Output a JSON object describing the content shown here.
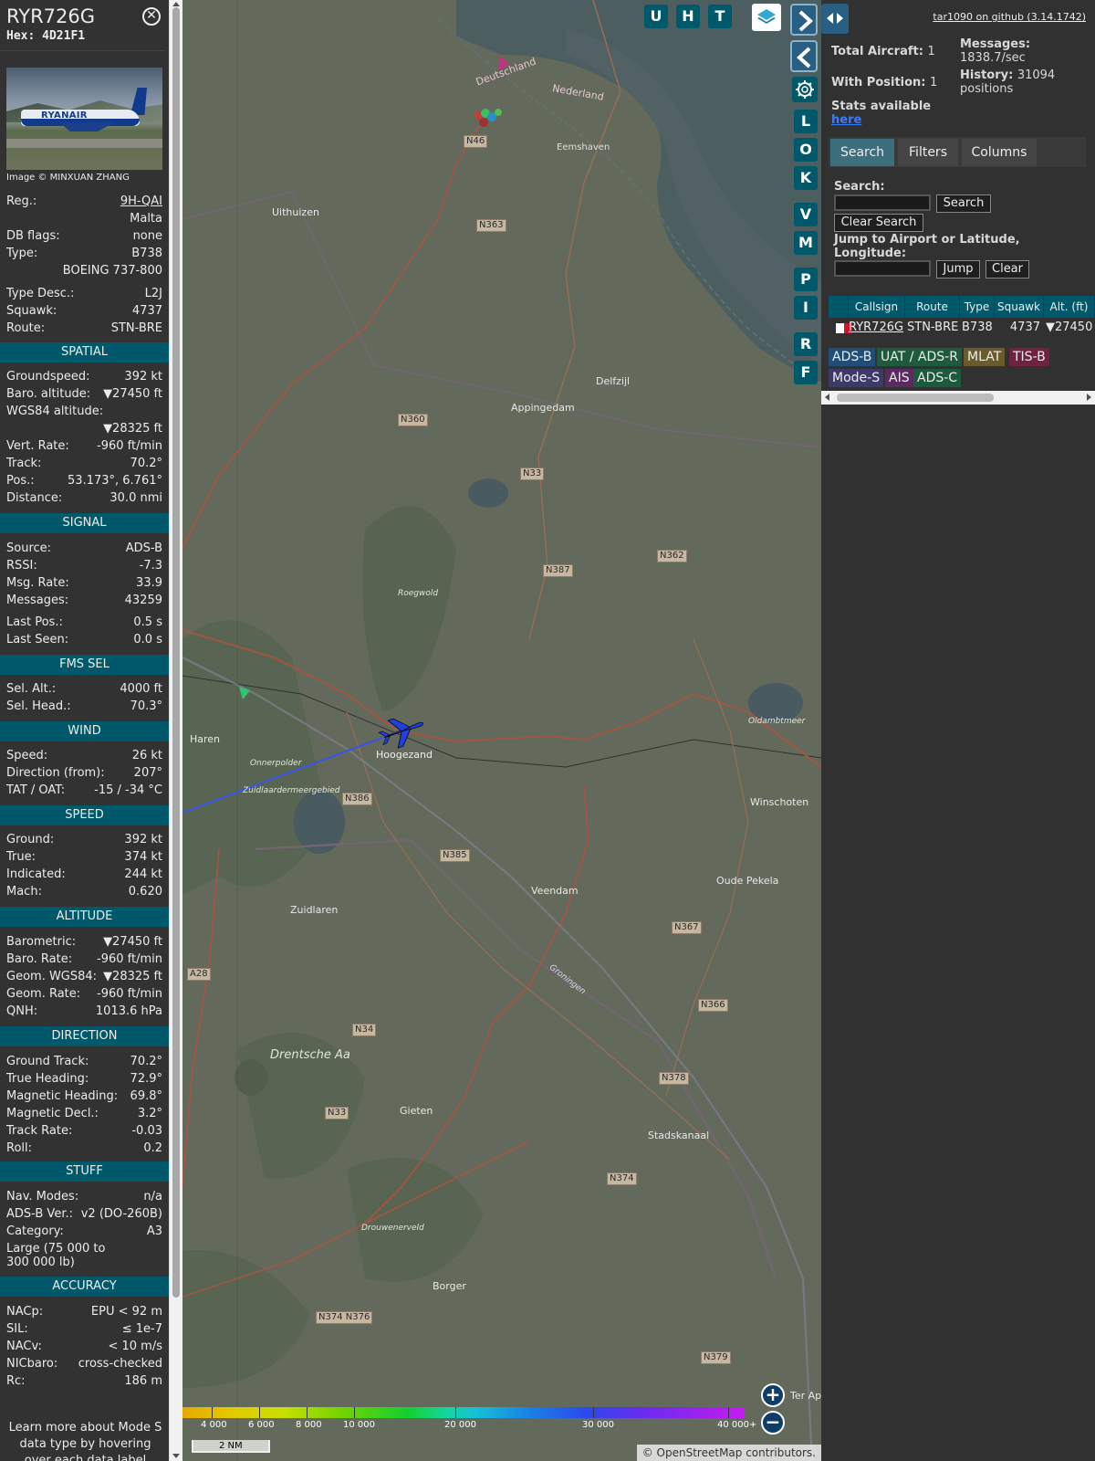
{
  "info": {
    "callsign": "RYR726G",
    "hex_label": "Hex:",
    "hex": "4D21F1",
    "photo_credit": "Image © MINXUAN ZHANG",
    "photo_brand": "RYANAIR",
    "rows_top": [
      {
        "k": "Reg.:",
        "v": "9H-QAI"
      },
      {
        "k": "",
        "v": "Malta"
      },
      {
        "k": "DB flags:",
        "v": "none"
      },
      {
        "k": "Type:",
        "v": "B738"
      },
      {
        "k": "",
        "v": "BOEING 737-800"
      }
    ],
    "rows_top2": [
      {
        "k": "Type Desc.:",
        "v": "L2J"
      },
      {
        "k": "Squawk:",
        "v": "4737"
      },
      {
        "k": "Route:",
        "v": "STN-BRE"
      }
    ],
    "sections": {
      "spatial": "SPATIAL",
      "signal": "SIGNAL",
      "fms": "FMS SEL",
      "wind": "WIND",
      "speed": "SPEED",
      "altitude": "ALTITUDE",
      "direction": "DIRECTION",
      "stuff": "STUFF",
      "accuracy": "ACCURACY"
    },
    "spatial": [
      {
        "k": "Groundspeed:",
        "v": "392 kt"
      },
      {
        "k": "Baro. altitude:",
        "v": "▼27450 ft"
      },
      {
        "k": "WGS84 altitude:",
        "v": ""
      },
      {
        "k": "",
        "v": "▼28325 ft"
      },
      {
        "k": "Vert. Rate:",
        "v": "-960 ft/min"
      },
      {
        "k": "Track:",
        "v": "70.2°"
      },
      {
        "k": "Pos.:",
        "v": "53.173°, 6.761°"
      },
      {
        "k": "Distance:",
        "v": "30.0 nmi"
      }
    ],
    "signal": [
      {
        "k": "Source:",
        "v": "ADS-B"
      },
      {
        "k": "RSSI:",
        "v": "-7.3"
      },
      {
        "k": "Msg. Rate:",
        "v": "33.9"
      },
      {
        "k": "Messages:",
        "v": "43259"
      }
    ],
    "signal2": [
      {
        "k": "Last Pos.:",
        "v": "0.5 s"
      },
      {
        "k": "Last Seen:",
        "v": "0.0 s"
      }
    ],
    "fms": [
      {
        "k": "Sel. Alt.:",
        "v": "4000 ft"
      },
      {
        "k": "Sel. Head.:",
        "v": "70.3°"
      }
    ],
    "wind": [
      {
        "k": "Speed:",
        "v": "26 kt"
      },
      {
        "k": "Direction (from):",
        "v": "207°"
      },
      {
        "k": "TAT / OAT:",
        "v": "-15 / -34 °C"
      }
    ],
    "speed": [
      {
        "k": "Ground:",
        "v": "392 kt"
      },
      {
        "k": "True:",
        "v": "374 kt"
      },
      {
        "k": "Indicated:",
        "v": "244 kt"
      },
      {
        "k": "Mach:",
        "v": "0.620"
      }
    ],
    "altitude": [
      {
        "k": "Barometric:",
        "v": "▼27450 ft"
      },
      {
        "k": "Baro. Rate:",
        "v": "-960 ft/min"
      },
      {
        "k": "Geom. WGS84:",
        "v": "▼28325 ft"
      },
      {
        "k": "Geom. Rate:",
        "v": "-960 ft/min"
      },
      {
        "k": "QNH:",
        "v": "1013.6 hPa"
      }
    ],
    "direction": [
      {
        "k": "Ground Track:",
        "v": "70.2°"
      },
      {
        "k": "True Heading:",
        "v": "72.9°"
      },
      {
        "k": "Magnetic Heading:",
        "v": "69.8°"
      },
      {
        "k": "Magnetic Decl.:",
        "v": "3.2°"
      },
      {
        "k": "Track Rate:",
        "v": "-0.03"
      },
      {
        "k": "Roll:",
        "v": "0.2"
      }
    ],
    "stuff": [
      {
        "k": "Nav. Modes:",
        "v": "n/a"
      },
      {
        "k": "ADS-B Ver.:",
        "v": "v2 (DO-260B)"
      },
      {
        "k": "Category:",
        "v": "A3"
      }
    ],
    "category_desc_1": "Large (75 000 to",
    "category_desc_2": "300 000 lb)",
    "accuracy": [
      {
        "k": "NACp:",
        "v": "EPU < 92 m"
      },
      {
        "k": "SIL:",
        "v": "≤ 1e-7"
      },
      {
        "k": "NACv:",
        "v": "< 10 m/s"
      },
      {
        "k": "NICbaro:",
        "v": "cross-checked"
      },
      {
        "k": "Rc:",
        "v": "186 m"
      }
    ],
    "footer": "Learn more about Mode S data type by hovering over each data label"
  },
  "map": {
    "buttons": [
      "U",
      "H",
      "T"
    ],
    "side_buttons": [
      "L",
      "O",
      "K",
      "V",
      "M",
      "P",
      "I",
      "R",
      "F"
    ],
    "places": [
      {
        "name": "Deutschland"
      },
      {
        "name": "Nederland"
      },
      {
        "name": "Eemshaven"
      },
      {
        "name": "Uithuizen"
      },
      {
        "name": "Delfzijl"
      },
      {
        "name": "Appingedam"
      },
      {
        "name": "Hoogezand"
      },
      {
        "name": "Haren"
      },
      {
        "name": "Winschoten"
      },
      {
        "name": "Veendam"
      },
      {
        "name": "Zuidlaren"
      },
      {
        "name": "Oude Pekela"
      },
      {
        "name": "Gieten"
      },
      {
        "name": "Stadskanaal"
      },
      {
        "name": "Borger"
      },
      {
        "name": "Drentsche Aa"
      },
      {
        "name": "Roegwold"
      },
      {
        "name": "Onnerpolder"
      },
      {
        "name": "Zuidlaardermeergebied"
      },
      {
        "name": "Oldambtmeer"
      },
      {
        "name": "Drouwenerveld"
      },
      {
        "name": "Groningen"
      },
      {
        "name": "Ter Ap"
      }
    ],
    "roads": [
      "N46",
      "N363",
      "N360",
      "N33",
      "N362",
      "N387",
      "N386",
      "N385",
      "N367",
      "N366",
      "N34",
      "N378",
      "N33",
      "N374",
      "N374 N376",
      "N379",
      "A28"
    ],
    "colorbar_labels": [
      "4 000",
      "6 000",
      "8 000",
      "10 000",
      "20 000",
      "30 000",
      "40 000+"
    ],
    "scale": "2 NM",
    "attribution": "© OpenStreetMap contributors."
  },
  "sidebar": {
    "github": "tar1090 on github (3.14.1742)",
    "total_label": "Total Aircraft:",
    "total": "1",
    "withpos_label": "With Position:",
    "withpos": "1",
    "messages_label": "Messages:",
    "messages": "1838.7/sec",
    "history_label": "History:",
    "history": "31094 positions",
    "stats_label": "Stats available",
    "stats_link": "here",
    "tabs": [
      "Search",
      "Filters",
      "Columns"
    ],
    "search_label": "Search:",
    "search_button": "Search",
    "clear_search": "Clear Search",
    "jump_label": "Jump to Airport or Latitude, Longitude:",
    "jump_button": "Jump",
    "clear_button": "Clear",
    "columns": [
      "Callsign",
      "Route",
      "Type",
      "Squawk",
      "Alt. (ft)"
    ],
    "row": {
      "callsign": "RYR726G",
      "route": "STN-BRE",
      "type": "B738",
      "squawk": "4737",
      "alt": "▼27450"
    },
    "sources": [
      {
        "label": "ADS-B",
        "color": "#1f4f79"
      },
      {
        "label": "UAT / ADS-R",
        "color": "#1e5b3c"
      },
      {
        "label": "MLAT",
        "color": "#6b5a2a"
      },
      {
        "label": "TIS-B",
        "color": "#6e2240"
      },
      {
        "label": "Mode-S",
        "color": "#3d3a6b"
      },
      {
        "label": "AIS",
        "color": "#5b2a5e"
      },
      {
        "label": "ADS-C",
        "color": "#1c5a3e"
      }
    ]
  }
}
